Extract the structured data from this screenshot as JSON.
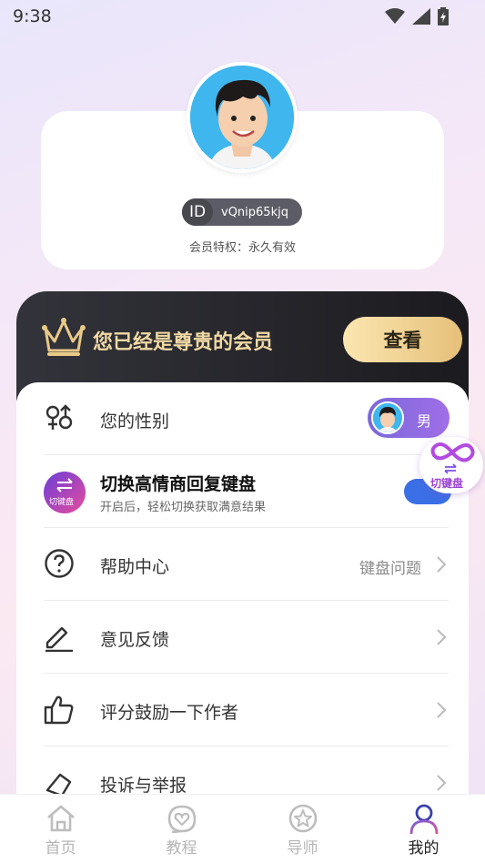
{
  "status_bar": {
    "time": "9:38"
  },
  "profile": {
    "id_badge": "ID",
    "id_value": "vQnip65kjq",
    "member_privilege": "会员特权：永久有效"
  },
  "vip_banner": {
    "text": "您已经是尊贵的会员",
    "button_label": "查看"
  },
  "settings": {
    "gender": {
      "label": "您的性别",
      "value": "男"
    },
    "keyboard": {
      "badge_label": "切键盘",
      "title": "切换高情商回复键盘",
      "subtitle": "开启后，轻松切换获取满意结果",
      "enabled": true
    },
    "help": {
      "label": "帮助中心",
      "extra": "键盘问题"
    },
    "feedback": {
      "label": "意见反馈"
    },
    "rate": {
      "label": "评分鼓励一下作者"
    },
    "report": {
      "label": "投诉与举报"
    }
  },
  "floating_button": {
    "label": "切键盘"
  },
  "tabs": [
    {
      "label": "首页",
      "icon": "home-icon",
      "active": false
    },
    {
      "label": "教程",
      "icon": "heart-chat-icon",
      "active": false
    },
    {
      "label": "导师",
      "icon": "star-icon",
      "active": false
    },
    {
      "label": "我的",
      "icon": "person-icon",
      "active": true
    }
  ],
  "colors": {
    "accent_purple": "#8b6ce0",
    "toggle_blue": "#3b6fe6",
    "vip_gold": "#f1d9a3",
    "vip_dark": "#1b1b1f"
  }
}
